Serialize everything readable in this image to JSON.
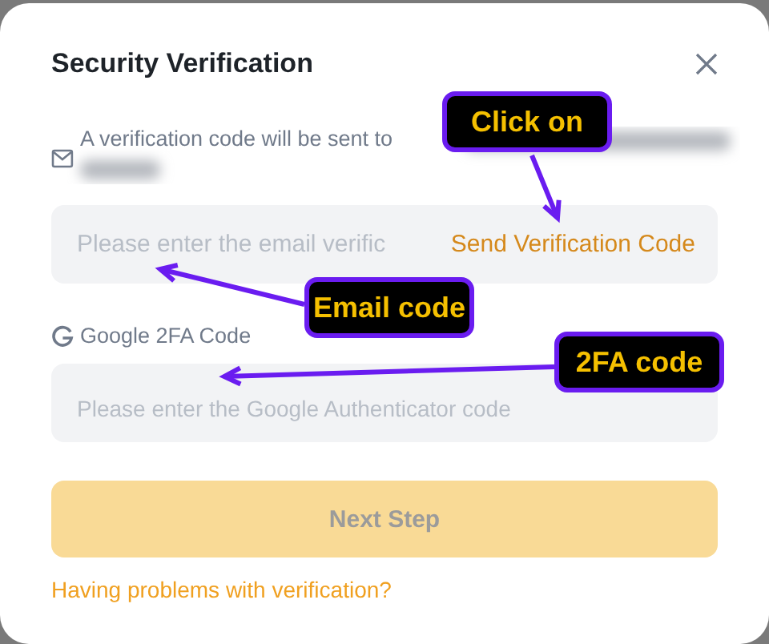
{
  "dialog": {
    "title": "Security Verification",
    "description": "A verification code will be sent to"
  },
  "email_field": {
    "placeholder": "Please enter the email verific",
    "action": "Send Verification Code"
  },
  "google_label": "Google 2FA Code",
  "google_field": {
    "placeholder": "Please enter the Google Authenticator code"
  },
  "next_button": {
    "label": "Next Step",
    "disabled": true
  },
  "help_link": "Having problems with verification?",
  "annotations": [
    {
      "text": "Click on"
    },
    {
      "text": "Email code"
    },
    {
      "text": "2FA code"
    }
  ]
}
